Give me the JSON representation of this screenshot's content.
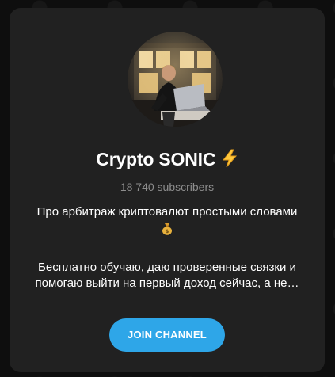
{
  "channel": {
    "title": "Crypto SONIC",
    "title_emoji": "lightning-icon",
    "subscribers": "18 740 subscribers",
    "description_line1": "Про арбитраж криптовалют простыми словами",
    "description_emoji": "money-bag-icon",
    "description_line2": "Бесплатно обучаю, даю проверенные связки и",
    "description_line3": "помогаю выйти на первый доход сейчас, а не…",
    "avatar": "channel-avatar-photo"
  },
  "actions": {
    "join_label": "JOIN CHANNEL"
  },
  "colors": {
    "background": "#0e0e0e",
    "card": "#212121",
    "accent": "#2ea6e8",
    "muted_text": "#8d8d8d",
    "text": "#ffffff"
  }
}
